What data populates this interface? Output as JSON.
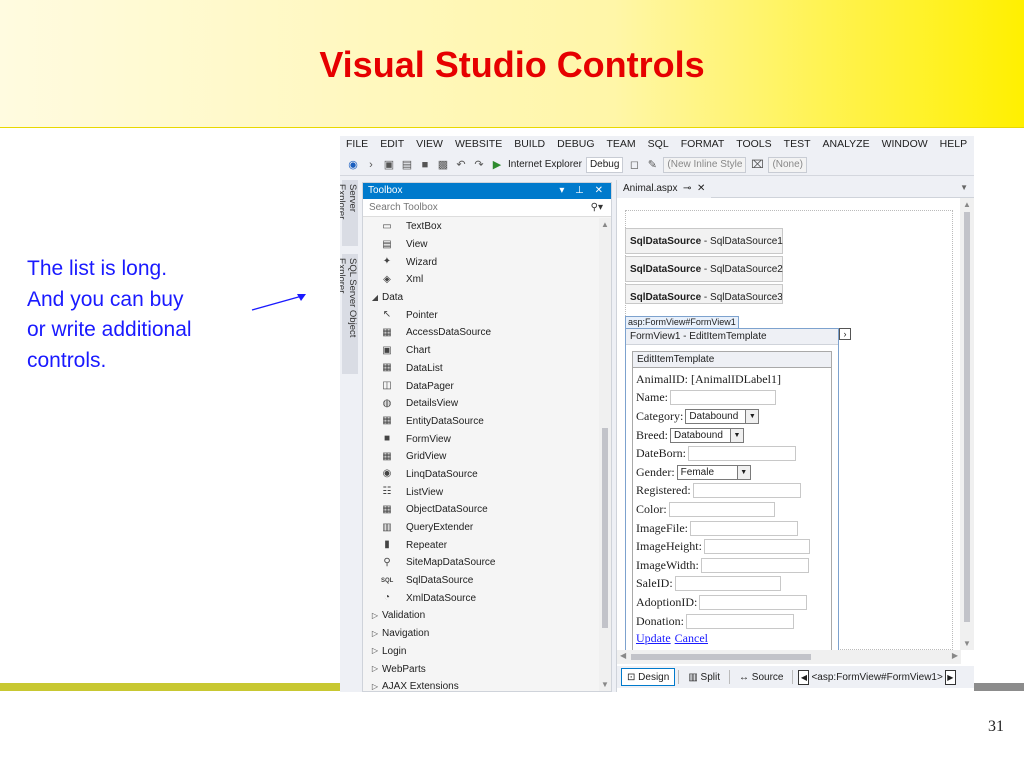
{
  "slide": {
    "title": "Visual Studio Controls",
    "note_lines": [
      "The list is long.",
      "And you can buy",
      "or write additional",
      "controls."
    ],
    "page_number": "31"
  },
  "ide": {
    "menu": [
      "FILE",
      "EDIT",
      "VIEW",
      "WEBSITE",
      "BUILD",
      "DEBUG",
      "TEAM",
      "SQL",
      "FORMAT",
      "TOOLS",
      "TEST",
      "ANALYZE",
      "WINDOW",
      "HELP"
    ],
    "toolbar": {
      "browser": "Internet Explorer",
      "config": "Debug",
      "style_box": "(New Inline Style",
      "target_box": "(None)"
    },
    "vertical_tabs": [
      "Server Explorer",
      "SQL Server Object Explorer"
    ],
    "toolbox": {
      "title": "Toolbox",
      "search_placeholder": "Search Toolbox",
      "items": [
        {
          "label": "TextBox",
          "icon": "textbox-icon",
          "glyph": "▭",
          "kind": "item"
        },
        {
          "label": "View",
          "icon": "view-icon",
          "glyph": "▤",
          "kind": "item"
        },
        {
          "label": "Wizard",
          "icon": "wizard-icon",
          "glyph": "✦",
          "kind": "item"
        },
        {
          "label": "Xml",
          "icon": "xml-icon",
          "glyph": "◈",
          "kind": "item"
        },
        {
          "label": "Data",
          "icon": "expanded-triangle-icon",
          "glyph": "◢",
          "kind": "cat"
        },
        {
          "label": "Pointer",
          "icon": "pointer-icon",
          "glyph": "↖",
          "kind": "item"
        },
        {
          "label": "AccessDataSource",
          "icon": "accessdatasource-icon",
          "glyph": "▦",
          "kind": "item"
        },
        {
          "label": "Chart",
          "icon": "chart-icon",
          "glyph": "▣",
          "kind": "item"
        },
        {
          "label": "DataList",
          "icon": "datalist-icon",
          "glyph": "▦",
          "kind": "item"
        },
        {
          "label": "DataPager",
          "icon": "datapager-icon",
          "glyph": "◫",
          "kind": "item"
        },
        {
          "label": "DetailsView",
          "icon": "detailsview-icon",
          "glyph": "◍",
          "kind": "item"
        },
        {
          "label": "EntityDataSource",
          "icon": "entitydatasource-icon",
          "glyph": "▦",
          "kind": "item"
        },
        {
          "label": "FormView",
          "icon": "formview-icon",
          "glyph": "■",
          "kind": "item"
        },
        {
          "label": "GridView",
          "icon": "gridview-icon",
          "glyph": "▦",
          "kind": "item"
        },
        {
          "label": "LinqDataSource",
          "icon": "linqdatasource-icon",
          "glyph": "◉",
          "kind": "item"
        },
        {
          "label": "ListView",
          "icon": "listview-icon",
          "glyph": "☷",
          "kind": "item"
        },
        {
          "label": "ObjectDataSource",
          "icon": "objectdatasource-icon",
          "glyph": "▦",
          "kind": "item"
        },
        {
          "label": "QueryExtender",
          "icon": "queryextender-icon",
          "glyph": "▥",
          "kind": "item"
        },
        {
          "label": "Repeater",
          "icon": "repeater-icon",
          "glyph": "▮",
          "kind": "item"
        },
        {
          "label": "SiteMapDataSource",
          "icon": "sitemapdatasource-icon",
          "glyph": "⚲",
          "kind": "item"
        },
        {
          "label": "SqlDataSource",
          "icon": "sqldatasource-icon",
          "glyph": "SQL",
          "kind": "item"
        },
        {
          "label": "XmlDataSource",
          "icon": "xmldatasource-icon",
          "glyph": "◔",
          "kind": "item"
        },
        {
          "label": "Validation",
          "icon": "collapsed-triangle-icon",
          "glyph": "▷",
          "kind": "cat"
        },
        {
          "label": "Navigation",
          "icon": "collapsed-triangle-icon",
          "glyph": "▷",
          "kind": "cat"
        },
        {
          "label": "Login",
          "icon": "collapsed-triangle-icon",
          "glyph": "▷",
          "kind": "cat"
        },
        {
          "label": "WebParts",
          "icon": "collapsed-triangle-icon",
          "glyph": "▷",
          "kind": "cat"
        },
        {
          "label": "AJAX Extensions",
          "icon": "collapsed-triangle-icon",
          "glyph": "▷",
          "kind": "cat"
        }
      ]
    },
    "editor": {
      "tab": "Animal.aspx",
      "datasources": [
        {
          "bold": "SqlDataSource",
          "rest": " - SqlDataSource1"
        },
        {
          "bold": "SqlDataSource",
          "rest": " - SqlDataSource2"
        },
        {
          "bold": "SqlDataSource",
          "rest": " - SqlDataSource3"
        }
      ],
      "asp_tag": "asp:FormView#FormView1",
      "formview_title": "FormView1 - EditItemTemplate",
      "template_title": "EditItemTemplate",
      "fields": [
        {
          "label": "AnimalID: [AnimalIDLabel1]",
          "type": "text"
        },
        {
          "label": "Name:",
          "type": "input"
        },
        {
          "label": "Category:",
          "type": "select",
          "value": "Databound"
        },
        {
          "label": "Breed:",
          "type": "select",
          "value": "Databound"
        },
        {
          "label": "DateBorn:",
          "type": "input"
        },
        {
          "label": "Gender:",
          "type": "select",
          "value": "Female"
        },
        {
          "label": "Registered:",
          "type": "input"
        },
        {
          "label": "Color:",
          "type": "input"
        },
        {
          "label": "ImageFile:",
          "type": "input"
        },
        {
          "label": "ImageHeight:",
          "type": "input"
        },
        {
          "label": "ImageWidth:",
          "type": "input"
        },
        {
          "label": "SaleID:",
          "type": "input"
        },
        {
          "label": "AdoptionID:",
          "type": "input"
        },
        {
          "label": "Donation:",
          "type": "input"
        }
      ],
      "update_link": "Update",
      "cancel_link": "Cancel"
    },
    "status": {
      "design": "Design",
      "split": "Split",
      "source": "Source",
      "breadcrumb": "<asp:FormView#FormView1>"
    }
  }
}
